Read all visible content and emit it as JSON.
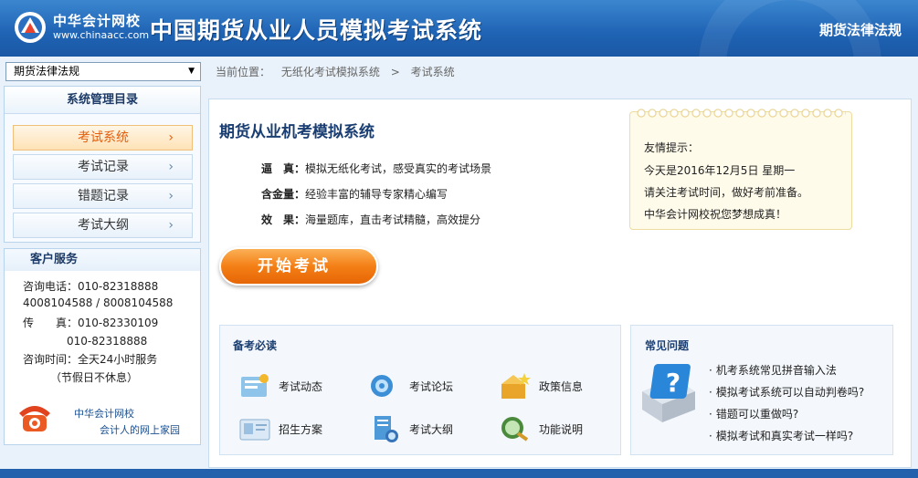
{
  "header": {
    "logo_cn": "中华会计网校",
    "logo_url": "www.chinaacc.com",
    "system_title": "中国期货从业人员模拟考试系统",
    "subject": "期货法律法规"
  },
  "sidebar": {
    "subject_select": "期货法律法规",
    "menu_title": "系统管理目录",
    "items": [
      {
        "label": "考试系统",
        "active": true
      },
      {
        "label": "考试记录"
      },
      {
        "label": "错题记录"
      },
      {
        "label": "考试大纲"
      }
    ],
    "service": {
      "title": "客户服务",
      "lines": [
        "咨询电话：010-82318888",
        "4008104588 / 8008104588",
        "传　　真：010-82330109",
        "　　　　010-82318888",
        "咨询时间：全天24小时服务",
        "　　　（节假日不休息）"
      ],
      "footer_name": "中华会计网校",
      "footer_slogan": "会计人的网上家园"
    }
  },
  "breadcrumb": {
    "label": "当前位置：",
    "items": [
      "无纸化考试模拟系统",
      ">",
      "考试系统"
    ]
  },
  "main": {
    "title": "期货从业机考模拟系统",
    "features": [
      {
        "key": "逼　真：",
        "text": "模拟无纸化考试，感受真实的考试场景"
      },
      {
        "key": "含金量：",
        "text": "经验丰富的辅导专家精心编写"
      },
      {
        "key": "效　果：",
        "text": "海量题库，直击考试精髓，高效提分"
      }
    ],
    "start_button": "开始考试",
    "tip": {
      "title": "友情提示：",
      "lines": [
        "今天是2016年12月5日 星期一",
        "请关注考试时间，做好考前准备。",
        "中华会计网校祝您梦想成真！"
      ]
    },
    "prep": {
      "title": "备考必读",
      "items": [
        {
          "label": "考试动态",
          "icon": "news-icon"
        },
        {
          "label": "考试论坛",
          "icon": "forum-icon"
        },
        {
          "label": "政策信息",
          "icon": "policy-icon"
        },
        {
          "label": "招生方案",
          "icon": "enroll-icon"
        },
        {
          "label": "考试大纲",
          "icon": "syllabus-icon"
        },
        {
          "label": "功能说明",
          "icon": "help-icon"
        }
      ]
    },
    "faq": {
      "title": "常见问题",
      "items": [
        "机考系统常见拼音输入法",
        "模拟考试系统可以自动判卷吗?",
        "错题可以重做吗?",
        "模拟考试和真实考试一样吗?"
      ]
    }
  },
  "colors": {
    "brand_blue": "#1f63b4",
    "accent_orange": "#f47f16"
  }
}
